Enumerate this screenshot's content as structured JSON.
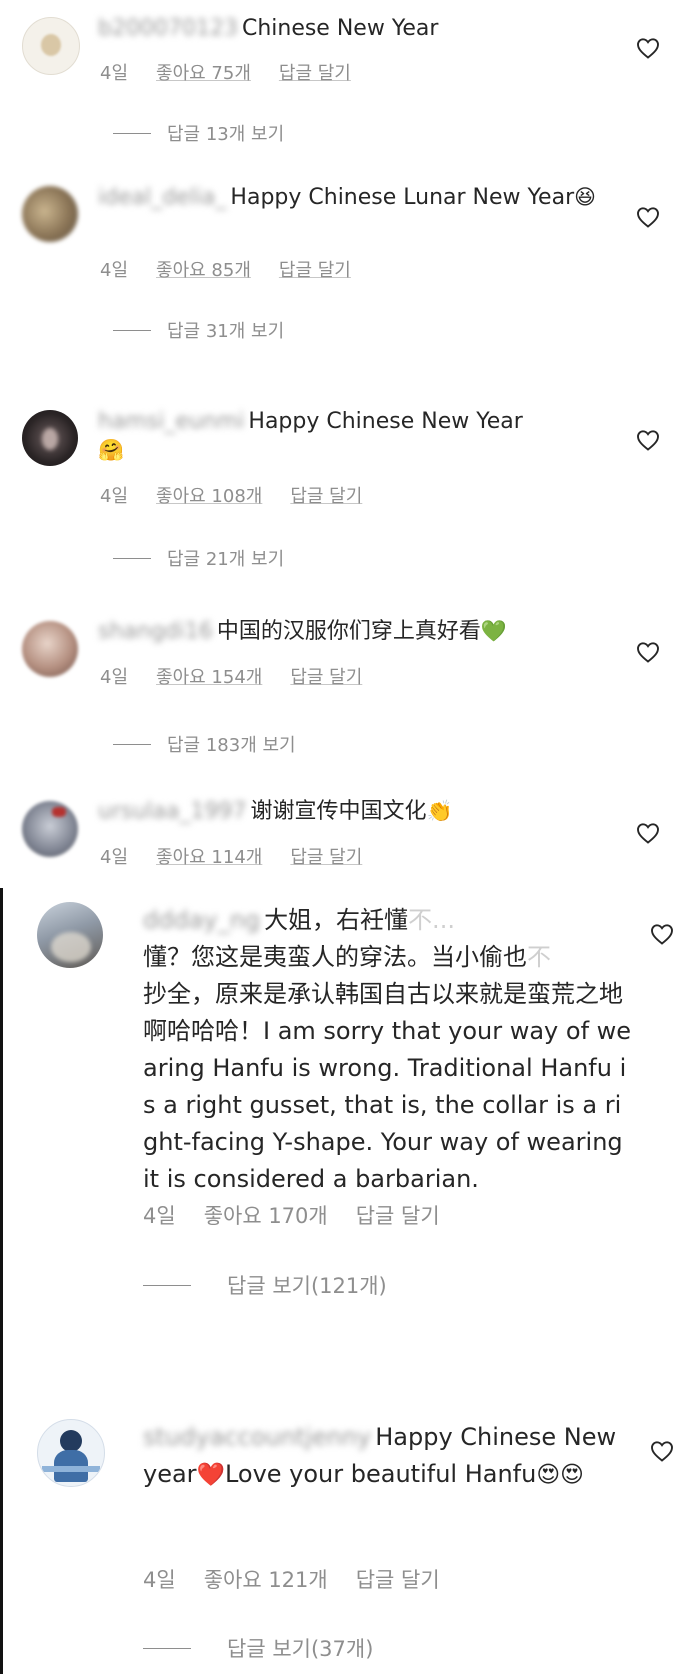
{
  "comments": [
    {
      "username": "b200070123",
      "text": "Chinese New Year",
      "emoji": "",
      "time": "4일",
      "likes": "좋아요 75개",
      "reply_label": "답글 달기",
      "replies": "답글 13개 보기",
      "avatar_color": "#e9e3d4"
    },
    {
      "username": "ideal_delia_",
      "text": "Happy Chinese Lunar New Year",
      "emoji": "😆",
      "time": "4일",
      "likes": "좋아요 85개",
      "reply_label": "답글 달기",
      "replies": "답글 31개 보기",
      "avatar_color": "#9b8a6b"
    },
    {
      "username": "hamsi_eunmi",
      "text": "Happy Chinese New Year",
      "emoji": "🤗",
      "time": "4일",
      "likes": "좋아요 108개",
      "reply_label": "답글 달기",
      "replies": "답글 21개 보기",
      "avatar_color": "#3a3334"
    },
    {
      "username": "shangdi16",
      "text": "中国的汉服你们穿上真好看",
      "emoji": "💚",
      "time": "4일",
      "likes": "좋아요 154개",
      "reply_label": "답글 달기",
      "replies": "답글 183개 보기",
      "avatar_color": "#c4a99c"
    },
    {
      "username": "ursulaa_1997",
      "text": "谢谢宣传中国文化",
      "emoji": "👏",
      "time": "4일",
      "likes": "좋아요 114개",
      "reply_label": "답글 달기",
      "replies": "",
      "avatar_color": "#8a8f9c"
    },
    {
      "username": "ddday_ng",
      "text_main": "大姐，右衽懂",
      "text_faded": "不...",
      "text_line2_a": "懂？您这是夷蛮人的穿法。当小偷也",
      "text_line2_faded": "不",
      "text_rest": "抄全，原来是承认韩国自古以来就是蛮荒之地啊哈哈哈！I am sorry that your way of wearing Hanfu is wrong. Traditional Hanfu is a right gusset, that is, the collar is a right-facing Y-shape. Your way of wearing it is considered a barbarian.",
      "time": "4일",
      "likes": "좋아요 170개",
      "reply_label": "답글 달기",
      "replies": "답글 보기(121개)",
      "avatar_color": "#9fa6b2"
    },
    {
      "username": "studyaccountjenny",
      "text": "Happy Chinese New year",
      "emoji_heart": "❤️",
      "text2": "Love your beautiful Hanfu",
      "emoji2": "😍😍",
      "time": "4일",
      "likes": "좋아요 121개",
      "reply_label": "답글 달기",
      "replies": "답글 보기(37개)",
      "avatar_color": "#3d6fa8"
    }
  ],
  "icons": {
    "like": "heart-outline-icon"
  }
}
